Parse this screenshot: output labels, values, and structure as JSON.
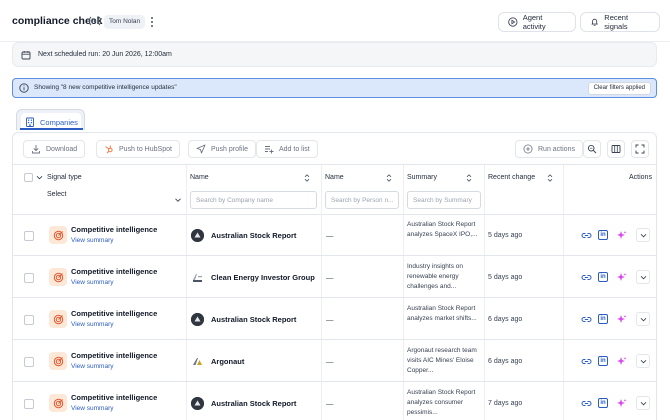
{
  "header": {
    "title": "compliance check",
    "user": "Tom Nolan",
    "agent_activity_label": "Agent activity",
    "recent_signals_label": "Recent signals"
  },
  "schedule": {
    "text": "Next scheduled run: 20 Jun 2026, 12:00am"
  },
  "filter_banner": {
    "text": "Showing \"8 new competitive intelligence updates\"",
    "clear_label": "Clear filters applied"
  },
  "tabs": [
    {
      "label": "Companies",
      "active": true
    }
  ],
  "toolbar": {
    "download": "Download",
    "push_hubspot": "Push to HubSpot",
    "push_profile": "Push profile",
    "add_to_list": "Add to list",
    "run_actions": "Run actions"
  },
  "columns": {
    "signal_type": "Signal type",
    "signal_select": "Select",
    "company_name": "Name",
    "company_placeholder": "Search by Company name",
    "person_name": "Name",
    "person_placeholder": "Search by Person n...",
    "summary": "Summary",
    "summary_placeholder": "Search by Summary",
    "recent_change": "Recent change",
    "actions": "Actions"
  },
  "rows": [
    {
      "signal": "Competitive intelligence",
      "link": "View summary",
      "company": "Australian Stock Report",
      "person": "—",
      "summary": "Australian Stock Report analyzes SpaceX IPO,...",
      "recent": "5 days ago",
      "logo": "asr"
    },
    {
      "signal": "Competitive intelligence",
      "link": "View summary",
      "company": "Clean Energy Investor Group",
      "person": "—",
      "summary": "Industry insights on renewable energy challenges and...",
      "recent": "5 days ago",
      "logo": "ceig"
    },
    {
      "signal": "Competitive intelligence",
      "link": "View summary",
      "company": "Australian Stock Report",
      "person": "—",
      "summary": "Australian Stock Report analyzes market shifts...",
      "recent": "6 days ago",
      "logo": "asr"
    },
    {
      "signal": "Competitive intelligence",
      "link": "View summary",
      "company": "Argonaut",
      "person": "—",
      "summary": "Argonaut research team visits AIC Mines' Eloise Copper...",
      "recent": "6 days ago",
      "logo": "argo"
    },
    {
      "signal": "Competitive intelligence",
      "link": "View summary",
      "company": "Australian Stock Report",
      "person": "—",
      "summary": "Australian Stock Report analyzes consumer pessimis...",
      "recent": "7 days ago",
      "logo": "asr"
    }
  ],
  "colors": {
    "accent": "#2b5cc4",
    "banner_bg": "#dbe8fb",
    "banner_border": "#5d8fe0",
    "signal_icon_bg": "#fde8d8",
    "signal_icon_fg": "#e4572e",
    "spark": "#d946ef"
  }
}
